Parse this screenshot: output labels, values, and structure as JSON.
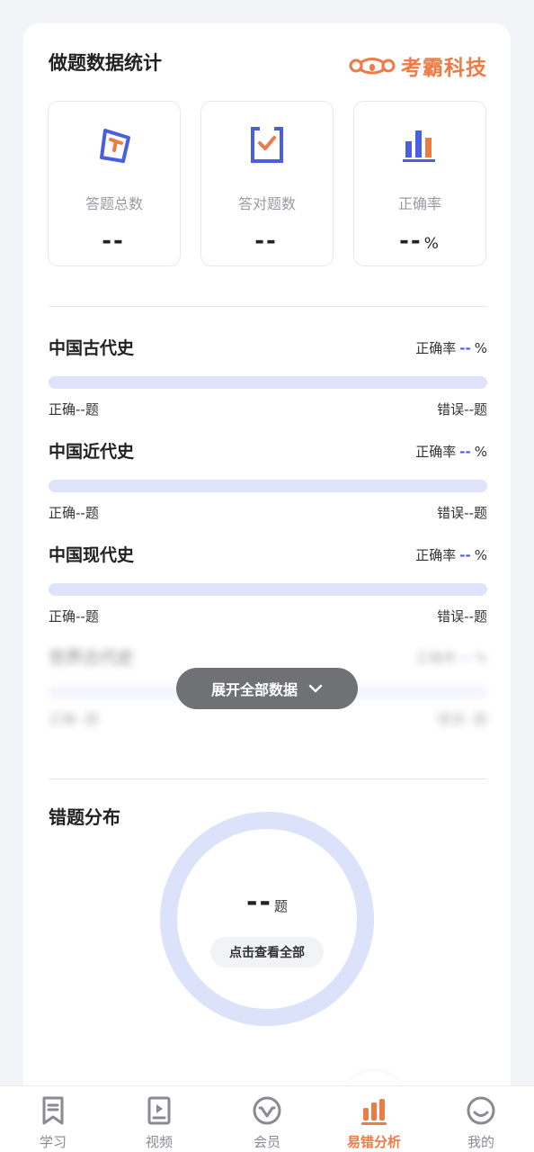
{
  "header": {
    "title": "做题数据统计",
    "brand": "考霸科技"
  },
  "stats": [
    {
      "label": "答题总数",
      "value": "--",
      "unit": "",
      "icon": "answer-total-icon"
    },
    {
      "label": "答对题数",
      "value": "--",
      "unit": "",
      "icon": "clipboard-check-icon"
    },
    {
      "label": "正确率",
      "value": "--",
      "unit": "%",
      "icon": "bar-chart-icon"
    }
  ],
  "subjects": [
    {
      "name": "中国古代史",
      "rate_label": "正确率",
      "rate_value": "--",
      "rate_unit": "%",
      "correct": "正确--题",
      "wrong": "错误--题"
    },
    {
      "name": "中国近代史",
      "rate_label": "正确率",
      "rate_value": "--",
      "rate_unit": "%",
      "correct": "正确--题",
      "wrong": "错误--题"
    },
    {
      "name": "中国现代史",
      "rate_label": "正确率",
      "rate_value": "--",
      "rate_unit": "%",
      "correct": "正确--题",
      "wrong": "错误--题"
    },
    {
      "name": "世界古代史",
      "rate_label": "正确率",
      "rate_value": "--",
      "rate_unit": "%",
      "correct": "正确--题",
      "wrong": "错误--题"
    }
  ],
  "expand_button": "展开全部数据",
  "wrong_dist": {
    "title": "错题分布",
    "count": "--",
    "unit": "题",
    "view_all": "点击查看全部"
  },
  "tabbar": [
    {
      "label": "学习",
      "icon": "bookmark-icon",
      "active": false
    },
    {
      "label": "视频",
      "icon": "video-icon",
      "active": false
    },
    {
      "label": "会员",
      "icon": "vip-icon",
      "active": false
    },
    {
      "label": "易错分析",
      "icon": "analysis-icon",
      "active": true
    },
    {
      "label": "我的",
      "icon": "smile-icon",
      "active": false
    }
  ],
  "colors": {
    "accent": "#ee7a45",
    "blue": "#4a5fe0",
    "bar_track": "#dfe3fb"
  }
}
